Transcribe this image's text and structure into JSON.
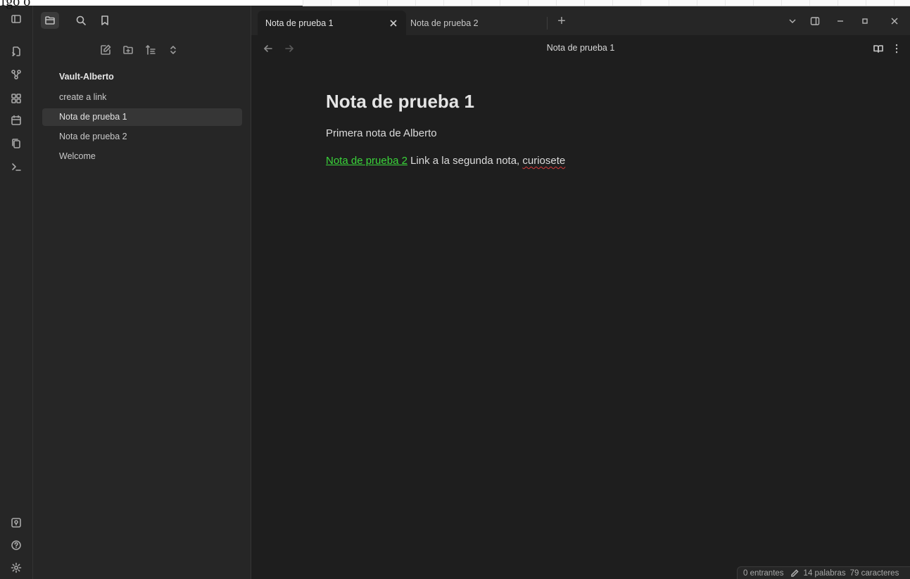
{
  "overlay": {
    "text": "rgo o"
  },
  "ribbon": {
    "top_icons": [
      "open-switcher-icon",
      "graph-view-icon",
      "canvas-icon",
      "daily-note-icon",
      "templates-icon",
      "terminal-icon"
    ],
    "bottom_icons": [
      "vault-switcher-icon",
      "help-icon",
      "settings-icon"
    ]
  },
  "sidebar": {
    "tabs": [
      "files-icon",
      "search-icon",
      "bookmarks-icon"
    ],
    "tools": [
      "new-note-icon",
      "new-folder-icon",
      "sort-icon",
      "collapse-icon"
    ],
    "vault_name": "Vault-Alberto",
    "files": [
      {
        "label": "create a link"
      },
      {
        "label": "Nota de prueba 1"
      },
      {
        "label": "Nota de prueba 2"
      },
      {
        "label": "Welcome"
      }
    ]
  },
  "tabs": {
    "active": "Nota de prueba 1",
    "inactive": "Nota de prueba 2",
    "new_tab": "+"
  },
  "view": {
    "title": "Nota de prueba 1"
  },
  "note": {
    "title": "Nota de prueba 1",
    "para1": "Primera nota de Alberto",
    "link_text": "Nota de prueba 2",
    "para2_rest": " Link a la segunda nota, ",
    "misspelled": "curiosete"
  },
  "status": {
    "backlinks": "0 entrantes",
    "words": "14 palabras",
    "chars": "79 caracteres"
  },
  "colors": {
    "app_bg": "#1e1e1e",
    "panel_bg": "#262626",
    "link": "#3ad43a",
    "spellcheck": "#d73a3a"
  }
}
